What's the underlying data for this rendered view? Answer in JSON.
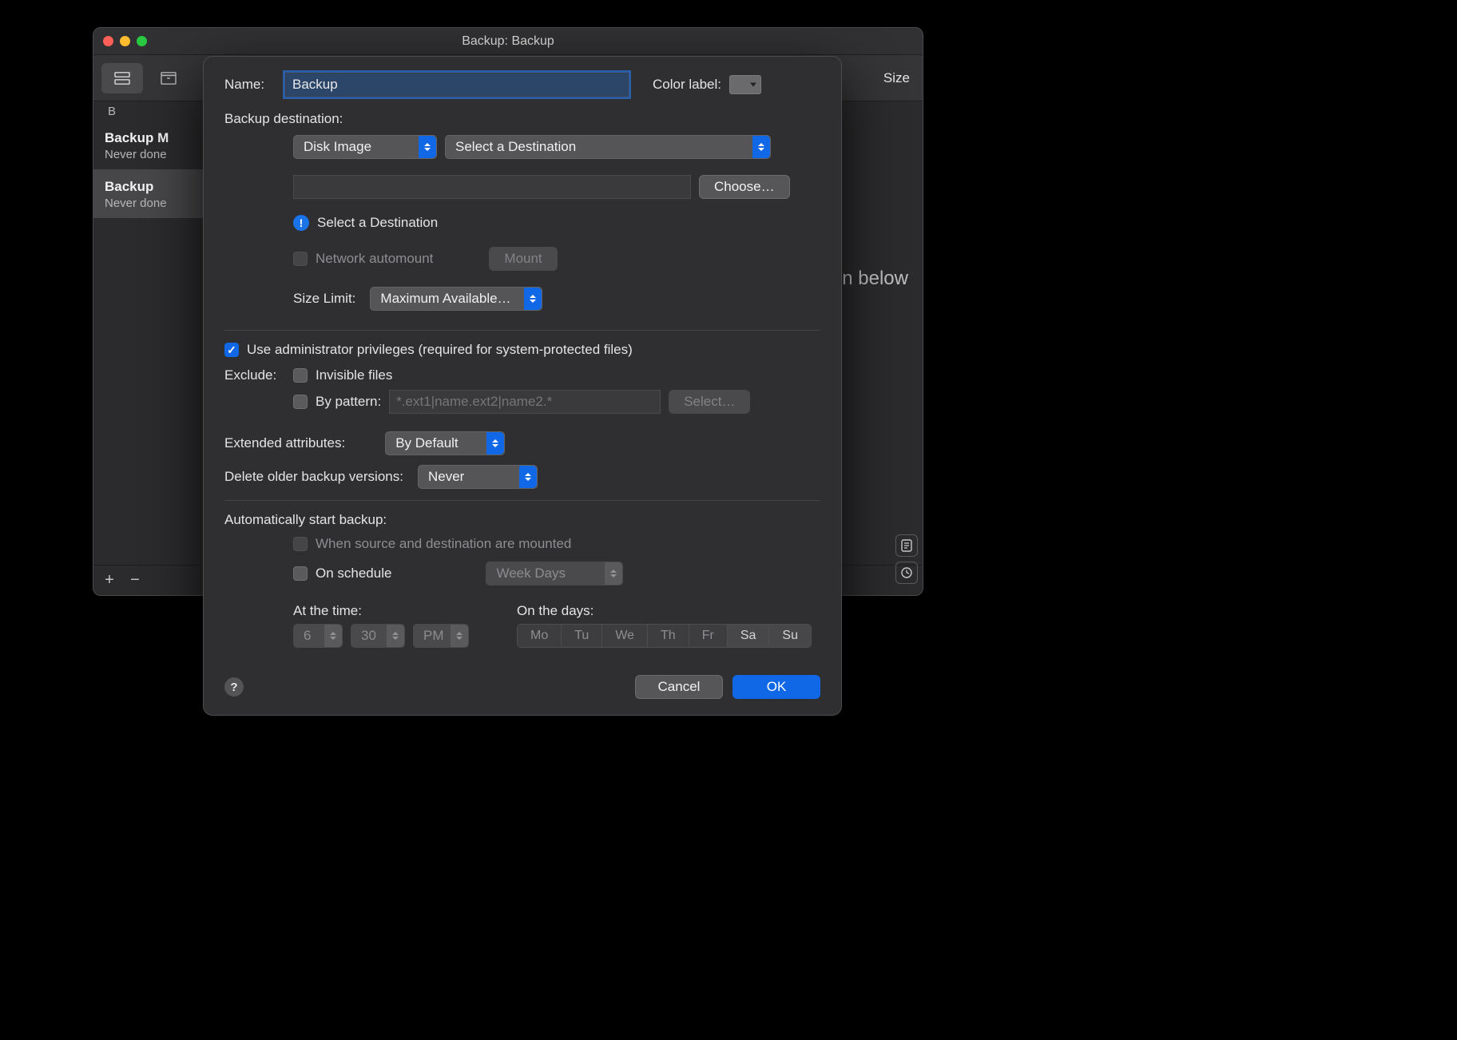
{
  "window": {
    "title": "Backup: Backup",
    "toolbar_right": "Size",
    "tab_sub": "B"
  },
  "sidebar": {
    "plans": [
      {
        "title": "Backup M",
        "sub": "Never done"
      },
      {
        "title": "Backup",
        "sub": "Never done"
      }
    ],
    "add": "+",
    "remove": "−"
  },
  "bg_content": {
    "hint_fragment": "n below"
  },
  "dialog": {
    "name_label": "Name:",
    "name_value": "Backup",
    "color_label": "Color label:",
    "dest_section": "Backup destination:",
    "dest_type": "Disk Image",
    "dest_select_placeholder": "Select a Destination",
    "choose": "Choose…",
    "dest_info": "Select a Destination",
    "network_automount": "Network automount",
    "mount": "Mount",
    "size_limit_label": "Size Limit:",
    "size_limit_value": "Maximum Available…",
    "admin_priv": "Use administrator privileges (required for system-protected files)",
    "exclude_label": "Exclude:",
    "invisible": "Invisible files",
    "by_pattern": "By pattern:",
    "pattern_placeholder": "*.ext1|name.ext2|name2.*",
    "select_btn": "Select…",
    "ext_attr_label": "Extended attributes:",
    "ext_attr_value": "By Default",
    "delete_older_label": "Delete older backup versions:",
    "delete_older_value": "Never",
    "auto_section": "Automatically start backup:",
    "auto_mounted": "When source and destination are mounted",
    "on_schedule": "On schedule",
    "schedule_mode": "Week Days",
    "at_time_label": "At the time:",
    "on_days_label": "On the days:",
    "time_h": "6",
    "time_m": "30",
    "time_ampm": "PM",
    "days": [
      "Mo",
      "Tu",
      "We",
      "Th",
      "Fr",
      "Sa",
      "Su"
    ],
    "cancel": "Cancel",
    "ok": "OK",
    "help": "?"
  }
}
